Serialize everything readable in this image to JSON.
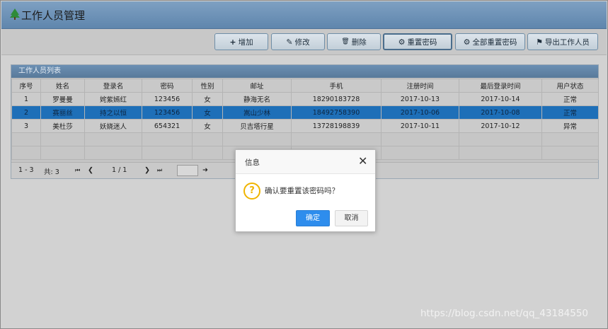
{
  "header": {
    "title": "工作人员管理",
    "tree_icon": "tree-icon"
  },
  "toolbar": {
    "add": {
      "icon": "+",
      "label": "增加"
    },
    "edit": {
      "icon": "✎",
      "label": "修改"
    },
    "delete": {
      "icon": "🗑",
      "label": "删除"
    },
    "reset": {
      "icon": "⚙",
      "label": "重置密码"
    },
    "reset_all": {
      "icon": "⚙",
      "label": "全部重置密码"
    },
    "export": {
      "icon": "⚑",
      "label": "导出工作人员"
    }
  },
  "panel": {
    "title": "工作人员列表"
  },
  "table": {
    "columns": [
      "序号",
      "姓名",
      "登录名",
      "密码",
      "性别",
      "邮址",
      "手机",
      "注册时间",
      "最后登录时间",
      "用户状态"
    ],
    "rows": [
      [
        "1",
        "罗曼曼",
        "姹紫嫣红",
        "123456",
        "女",
        "静海无名",
        "18290183728",
        "2017-10-13",
        "2017-10-14",
        "正常"
      ],
      [
        "2",
        "赛丽丝",
        "持之以恒",
        "123456",
        "女",
        "嵩山少林",
        "18492758390",
        "2017-10-06",
        "2017-10-08",
        "正常"
      ],
      [
        "3",
        "美杜莎",
        "妖娆迷人",
        "654321",
        "女",
        "贝吉塔行星",
        "13728198839",
        "2017-10-11",
        "2017-10-12",
        "异常"
      ]
    ],
    "selected_row": 2
  },
  "pager": {
    "range": "1 - 3",
    "total": "共: 3",
    "first": "⏮",
    "prev": "❮",
    "page": "1 / 1",
    "next": "❯",
    "last": "⏭",
    "go": "➜"
  },
  "dialog": {
    "title": "信息",
    "close": "✕",
    "icon": "?",
    "message": "确认要重置该密码吗？",
    "ok": "确定",
    "cancel": "取消"
  },
  "watermark": "https://blog.csdn.net/qq_43184550"
}
